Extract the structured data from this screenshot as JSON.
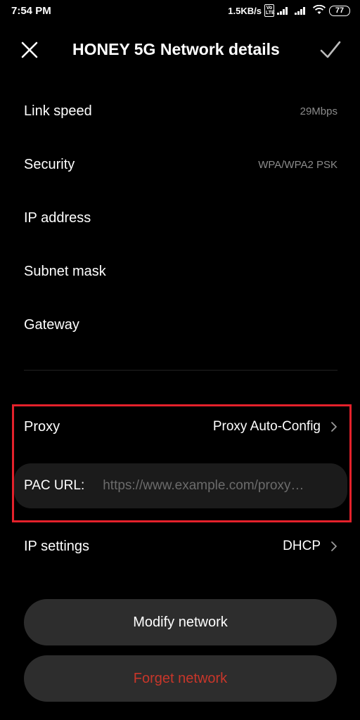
{
  "status_bar": {
    "time": "7:54 PM",
    "net_speed": "1.5KB/s",
    "volte_label": "Vo LTE",
    "battery": "77"
  },
  "header": {
    "title": "HONEY 5G Network details",
    "close_icon": "close-icon",
    "confirm_icon": "check-icon"
  },
  "details": [
    {
      "label": "Link speed",
      "value": "29Mbps"
    },
    {
      "label": "Security",
      "value": "WPA/WPA2 PSK"
    },
    {
      "label": "IP address",
      "value": ""
    },
    {
      "label": "Subnet mask",
      "value": ""
    },
    {
      "label": "Gateway",
      "value": ""
    }
  ],
  "proxy": {
    "label": "Proxy",
    "value": "Proxy Auto-Config"
  },
  "pac": {
    "label": "PAC URL:",
    "placeholder": "https://www.example.com/proxy…"
  },
  "ip_settings": {
    "label": "IP settings",
    "value": "DHCP"
  },
  "buttons": {
    "modify": "Modify network",
    "forget": "Forget network"
  },
  "colors": {
    "background": "#000000",
    "highlight": "#e4212b",
    "forget_text": "#c8362a",
    "button_bg": "#2d2d2d",
    "field_bg": "#1b1b1b"
  }
}
